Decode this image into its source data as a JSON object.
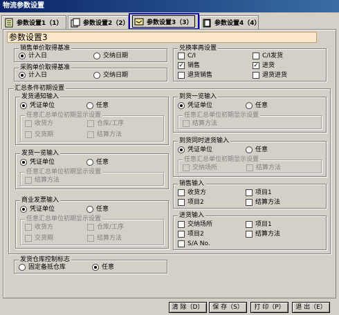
{
  "window": {
    "title": "物流参数设置"
  },
  "tabs": [
    {
      "label": "参数设置1（1）"
    },
    {
      "label": "参数设置2（2）"
    },
    {
      "label": "参数设置3（3）"
    },
    {
      "label": "参数设置4（4）"
    }
  ],
  "page": {
    "title": "参数设置3"
  },
  "sales_price": {
    "legend": "销售单价取得基准",
    "opt1": "计入日",
    "opt2": "交纳日期"
  },
  "purchase_price": {
    "legend": "采购单价取得基准",
    "opt1": "计入日",
    "opt2": "交纳日期"
  },
  "exchange": {
    "legend": "兑换率再设置",
    "ci": "C/I",
    "ci_send": "C/I发货",
    "sales": "销售",
    "purchase": "进货",
    "return_sales": "退货销售",
    "return_purchase": "退货进货"
  },
  "summary": {
    "legend": "汇总条件初期设置"
  },
  "delivery_notice": {
    "legend": "发货通知输入",
    "opt1": "凭证单位",
    "opt2": "任意",
    "sub_legend": "任意汇总单位初期显示设置",
    "item1": "收货方",
    "item2": "仓库/工序",
    "item3": "交货期",
    "item4": "结算方法"
  },
  "ship_list": {
    "legend": "发货一览输入",
    "opt1": "凭证单位",
    "opt2": "任意",
    "sub_legend": "任意汇总单位初期显示设置",
    "item1": "结算方法"
  },
  "commercial_invoice": {
    "legend": "商业发票输入",
    "opt1": "凭证单位",
    "opt2": "任意",
    "sub_legend": "任意汇总单位初期显示设置",
    "item1": "收货方",
    "item2": "仓库/工序",
    "item3": "交货期",
    "item4": "结算方法"
  },
  "warehouse_flag": {
    "legend": "发货仓库控制标志",
    "opt1": "固定备抵仓库",
    "opt2": "任意"
  },
  "arrival_list": {
    "legend": "到货一览输入",
    "opt1": "凭证单位",
    "opt2": "任意",
    "sub_legend": "任意汇总单位初期显示设置",
    "item1": "结算方法"
  },
  "arrival_purchase": {
    "legend": "到货同时进货输入",
    "opt1": "凭证单位",
    "opt2": "任意",
    "sub_legend": "任意汇总单位初期显示设置",
    "item1": "交纳场所",
    "item2": "结算方法"
  },
  "sales_input": {
    "legend": "销售输入",
    "item1": "收货方",
    "item2": "项目1",
    "item3": "项目2",
    "item4": "结算方法"
  },
  "purchase_input": {
    "legend": "进货输入",
    "item1": "交纳场所",
    "item2": "项目1",
    "item3": "项目2",
    "item4": "结算方法",
    "item5": "S/A No."
  },
  "buttons": {
    "clear": "清 除（D）",
    "save": "保 存（S）",
    "print": "打 印（P）",
    "exit": "退 出（E）"
  },
  "colors": {
    "active_tab_border": "#0000c8",
    "title_bar": "#0a246a",
    "page_head_bg": "#fce8c8"
  }
}
